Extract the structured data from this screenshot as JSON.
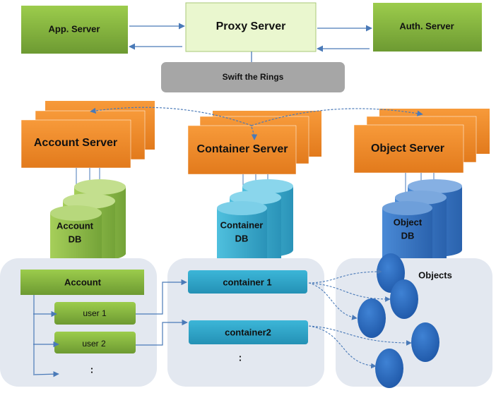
{
  "top": {
    "app_server": "App. Server",
    "proxy_server": "Proxy Server",
    "auth_server": "Auth. Server"
  },
  "rings": "Swift the Rings",
  "servers": {
    "account": "Account Server",
    "container": "Container Server",
    "object": "Object Server"
  },
  "dbs": {
    "account": [
      "Account",
      "DB"
    ],
    "container": [
      "Container",
      "DB"
    ],
    "object": [
      "Object",
      "DB"
    ]
  },
  "account_panel": {
    "title": "Account",
    "users": [
      "user 1",
      "user 2"
    ],
    "more": ":"
  },
  "container_panel": {
    "items": [
      "container 1",
      "container2"
    ],
    "more": ":"
  },
  "objects_panel": {
    "label": "Objects"
  },
  "colors": {
    "green": "#77a83a",
    "orange": "#f08a24",
    "cyan": "#33a7cc",
    "blue": "#2f6fbf",
    "gray": "#a6a6a6",
    "panel": "#e3e8f0"
  }
}
